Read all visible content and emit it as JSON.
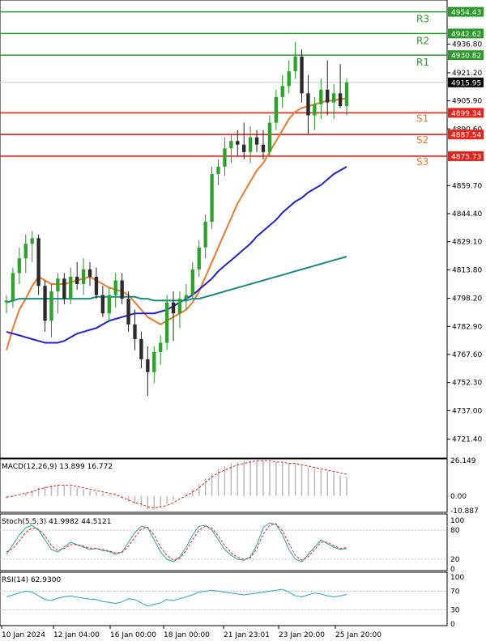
{
  "chart_data": [
    {
      "type": "candlestick",
      "panel": "price",
      "ylim": [
        4712,
        4960
      ],
      "y_ticks": [
        "4936.80",
        "4921.20",
        "4905.90",
        "4890.60",
        "4859.70",
        "4844.40",
        "4829.10",
        "4813.80",
        "4798.20",
        "4782.90",
        "4767.60",
        "4752.30",
        "4737.00",
        "4721.40"
      ],
      "x_labels": [
        "10 Jan 2024",
        "12 Jan 04:00",
        "16 Jan 00:00",
        "18 Jan 00:00",
        "21 Jan 23:01",
        "23 Jan 20:00",
        "25 Jan 20:00"
      ],
      "current_price": "4915.95",
      "levels": [
        {
          "name": "R3",
          "value": 4954.43,
          "text": "4954.43",
          "color": "#2a9a2a"
        },
        {
          "name": "R2",
          "value": 4942.62,
          "text": "4942.62",
          "color": "#2a9a2a"
        },
        {
          "name": "R1",
          "value": 4930.82,
          "text": "4930.82",
          "color": "#2a9a2a"
        },
        {
          "name": "S1",
          "value": 4899.34,
          "text": "4899.34",
          "color": "#e8211b"
        },
        {
          "name": "S2",
          "value": 4887.54,
          "text": "4887.54",
          "color": "#e8211b"
        },
        {
          "name": "S3",
          "value": 4875.73,
          "text": "4875.73",
          "color": "#e8211b"
        }
      ],
      "candles": [
        [
          4796,
          4800,
          4790,
          4797
        ],
        [
          4797,
          4815,
          4793,
          4812
        ],
        [
          4812,
          4826,
          4806,
          4820
        ],
        [
          4820,
          4833,
          4812,
          4828
        ],
        [
          4828,
          4835,
          4818,
          4831
        ],
        [
          4831,
          4833,
          4800,
          4805
        ],
        [
          4805,
          4808,
          4780,
          4786
        ],
        [
          4786,
          4806,
          4777,
          4802
        ],
        [
          4802,
          4812,
          4790,
          4809
        ],
        [
          4809,
          4812,
          4795,
          4798
        ],
        [
          4798,
          4815,
          4795,
          4810
        ],
        [
          4810,
          4818,
          4803,
          4806
        ],
        [
          4806,
          4820,
          4800,
          4814
        ],
        [
          4814,
          4818,
          4805,
          4810
        ],
        [
          4810,
          4815,
          4798,
          4800
        ],
        [
          4800,
          4805,
          4788,
          4790
        ],
        [
          4790,
          4804,
          4785,
          4800
        ],
        [
          4800,
          4812,
          4793,
          4808
        ],
        [
          4808,
          4812,
          4795,
          4798
        ],
        [
          4798,
          4802,
          4780,
          4784
        ],
        [
          4784,
          4792,
          4770,
          4776
        ],
        [
          4776,
          4780,
          4760,
          4765
        ],
        [
          4765,
          4772,
          4745,
          4758
        ],
        [
          4758,
          4772,
          4752,
          4769
        ],
        [
          4769,
          4778,
          4762,
          4774
        ],
        [
          4774,
          4800,
          4770,
          4796
        ],
        [
          4796,
          4802,
          4775,
          4790
        ],
        [
          4790,
          4802,
          4782,
          4798
        ],
        [
          4798,
          4806,
          4792,
          4800
        ],
        [
          4800,
          4818,
          4798,
          4814
        ],
        [
          4814,
          4830,
          4810,
          4826
        ],
        [
          4826,
          4844,
          4820,
          4840
        ],
        [
          4840,
          4870,
          4836,
          4866
        ],
        [
          4866,
          4874,
          4860,
          4870
        ],
        [
          4870,
          4886,
          4865,
          4880
        ],
        [
          4880,
          4888,
          4872,
          4884
        ],
        [
          4884,
          4890,
          4876,
          4882
        ],
        [
          4882,
          4894,
          4874,
          4878
        ],
        [
          4878,
          4892,
          4872,
          4886
        ],
        [
          4886,
          4890,
          4878,
          4882
        ],
        [
          4882,
          4890,
          4874,
          4878
        ],
        [
          4878,
          4898,
          4876,
          4894
        ],
        [
          4894,
          4912,
          4890,
          4908
        ],
        [
          4908,
          4920,
          4902,
          4914
        ],
        [
          4914,
          4928,
          4910,
          4922
        ],
        [
          4922,
          4938,
          4918,
          4930
        ],
        [
          4930,
          4934,
          4905,
          4910
        ],
        [
          4910,
          4920,
          4888,
          4898
        ],
        [
          4898,
          4908,
          4890,
          4904
        ],
        [
          4904,
          4918,
          4896,
          4912
        ],
        [
          4912,
          4928,
          4898,
          4905
        ],
        [
          4905,
          4915,
          4896,
          4910
        ],
        [
          4910,
          4926,
          4902,
          4903
        ],
        [
          4903,
          4918,
          4898,
          4916
        ]
      ],
      "moving_averages": [
        {
          "color": "#f07828",
          "values": [
            4770,
            4782,
            4792,
            4798,
            4805,
            4810,
            4808,
            4806,
            4806,
            4806,
            4807,
            4808,
            4809,
            4810,
            4808,
            4806,
            4804,
            4803,
            4802,
            4800,
            4796,
            4792,
            4788,
            4786,
            4784,
            4786,
            4788,
            4790,
            4792,
            4796,
            4802,
            4810,
            4818,
            4826,
            4834,
            4842,
            4850,
            4856,
            4862,
            4868,
            4872,
            4878,
            4884,
            4890,
            4896,
            4900,
            4902,
            4903,
            4904,
            4905,
            4906,
            4906,
            4907,
            4907
          ]
        },
        {
          "color": "#2222cc",
          "values": [
            4780,
            4779,
            4778,
            4777,
            4776,
            4775,
            4774,
            4774,
            4774,
            4775,
            4777,
            4779,
            4780,
            4781,
            4782,
            4784,
            4786,
            4787,
            4788,
            4789,
            4790,
            4790,
            4790,
            4790,
            4791,
            4792,
            4794,
            4796,
            4798,
            4800,
            4803,
            4806,
            4809,
            4813,
            4816,
            4819,
            4822,
            4825,
            4828,
            4832,
            4835,
            4838,
            4841,
            4845,
            4848,
            4851,
            4853,
            4856,
            4858,
            4860,
            4863,
            4866,
            4868,
            4870
          ]
        },
        {
          "color": "#1a8a80",
          "values": [
            4796,
            4797,
            4798,
            4798,
            4798,
            4798,
            4798,
            4798,
            4798,
            4798,
            4798,
            4798,
            4798,
            4798,
            4799,
            4799,
            4799,
            4799,
            4799,
            4799,
            4799,
            4798,
            4798,
            4797,
            4797,
            4797,
            4797,
            4797,
            4797,
            4798,
            4798,
            4799,
            4800,
            4801,
            4802,
            4803,
            4804,
            4805,
            4806,
            4807,
            4808,
            4809,
            4810,
            4811,
            4812,
            4813,
            4814,
            4815,
            4816,
            4817,
            4818,
            4819,
            4820,
            4821
          ]
        }
      ]
    },
    {
      "type": "bar",
      "panel": "macd",
      "title": "MACD(12,26,9) 13.899 16.772",
      "ylim": [
        -10.887,
        26.149
      ],
      "y_ticks": [
        "26.149",
        "0.00",
        "-10.887"
      ],
      "histogram": [
        -2,
        -1,
        0,
        2,
        4,
        6,
        7,
        8,
        8,
        8,
        7,
        6,
        5,
        4,
        3,
        2,
        1,
        0,
        -2,
        -4,
        -6,
        -8,
        -10,
        -10,
        -8,
        -6,
        -3,
        0,
        2,
        5,
        9,
        13,
        17,
        20,
        22,
        24,
        25,
        26,
        26,
        26,
        26,
        25,
        25,
        25,
        24,
        24,
        22,
        21,
        20,
        19,
        18,
        17,
        15,
        14
      ],
      "signal": [
        -1,
        0,
        1,
        2,
        3,
        5,
        6,
        7,
        8,
        8,
        8,
        7,
        6,
        5,
        4,
        3,
        2,
        1,
        -1,
        -3,
        -5,
        -6,
        -8,
        -9,
        -8,
        -7,
        -5,
        -2,
        0,
        3,
        6,
        10,
        14,
        17,
        19,
        21,
        23,
        24,
        25,
        26,
        26,
        26,
        25,
        25,
        24,
        24,
        23,
        22,
        21,
        20,
        19,
        18,
        17,
        16
      ]
    },
    {
      "type": "line",
      "panel": "stochastic",
      "title": "Stoch(5,5,3) 41.9982 44.5121",
      "ylim": [
        0,
        100
      ],
      "y_ticks": [
        "100",
        "80",
        "20",
        "0"
      ],
      "series": [
        {
          "color": "#2aa0a0",
          "values": [
            30,
            50,
            70,
            85,
            90,
            80,
            60,
            40,
            35,
            45,
            55,
            50,
            45,
            40,
            42,
            38,
            36,
            30,
            35,
            55,
            75,
            88,
            85,
            60,
            35,
            20,
            15,
            25,
            45,
            70,
            88,
            90,
            80,
            60,
            40,
            28,
            20,
            18,
            25,
            50,
            85,
            95,
            92,
            70,
            40,
            20,
            15,
            30,
            45,
            60,
            52,
            45,
            40,
            42
          ]
        },
        {
          "color": "#e8211b",
          "values": [
            35,
            42,
            58,
            75,
            85,
            82,
            68,
            48,
            38,
            42,
            50,
            50,
            47,
            43,
            42,
            40,
            37,
            33,
            34,
            47,
            65,
            82,
            86,
            70,
            45,
            28,
            18,
            22,
            38,
            60,
            80,
            88,
            84,
            68,
            48,
            33,
            24,
            20,
            23,
            42,
            72,
            90,
            93,
            78,
            52,
            28,
            18,
            25,
            40,
            55,
            55,
            48,
            42,
            44
          ]
        }
      ]
    },
    {
      "type": "line",
      "panel": "rsi",
      "title": "RSI(14) 62.9300",
      "ylim": [
        0,
        100
      ],
      "y_ticks": [
        "100",
        "70",
        "30",
        "0"
      ],
      "series": [
        {
          "color": "#2aa0c8",
          "values": [
            58,
            62,
            66,
            70,
            68,
            60,
            52,
            50,
            55,
            58,
            60,
            57,
            55,
            53,
            52,
            48,
            46,
            44,
            47,
            54,
            52,
            45,
            38,
            42,
            45,
            52,
            50,
            54,
            58,
            62,
            68,
            70,
            72,
            70,
            68,
            66,
            64,
            62,
            64,
            66,
            68,
            70,
            72,
            74,
            68,
            60,
            58,
            62,
            66,
            64,
            60,
            58,
            60,
            63
          ]
        }
      ]
    }
  ]
}
